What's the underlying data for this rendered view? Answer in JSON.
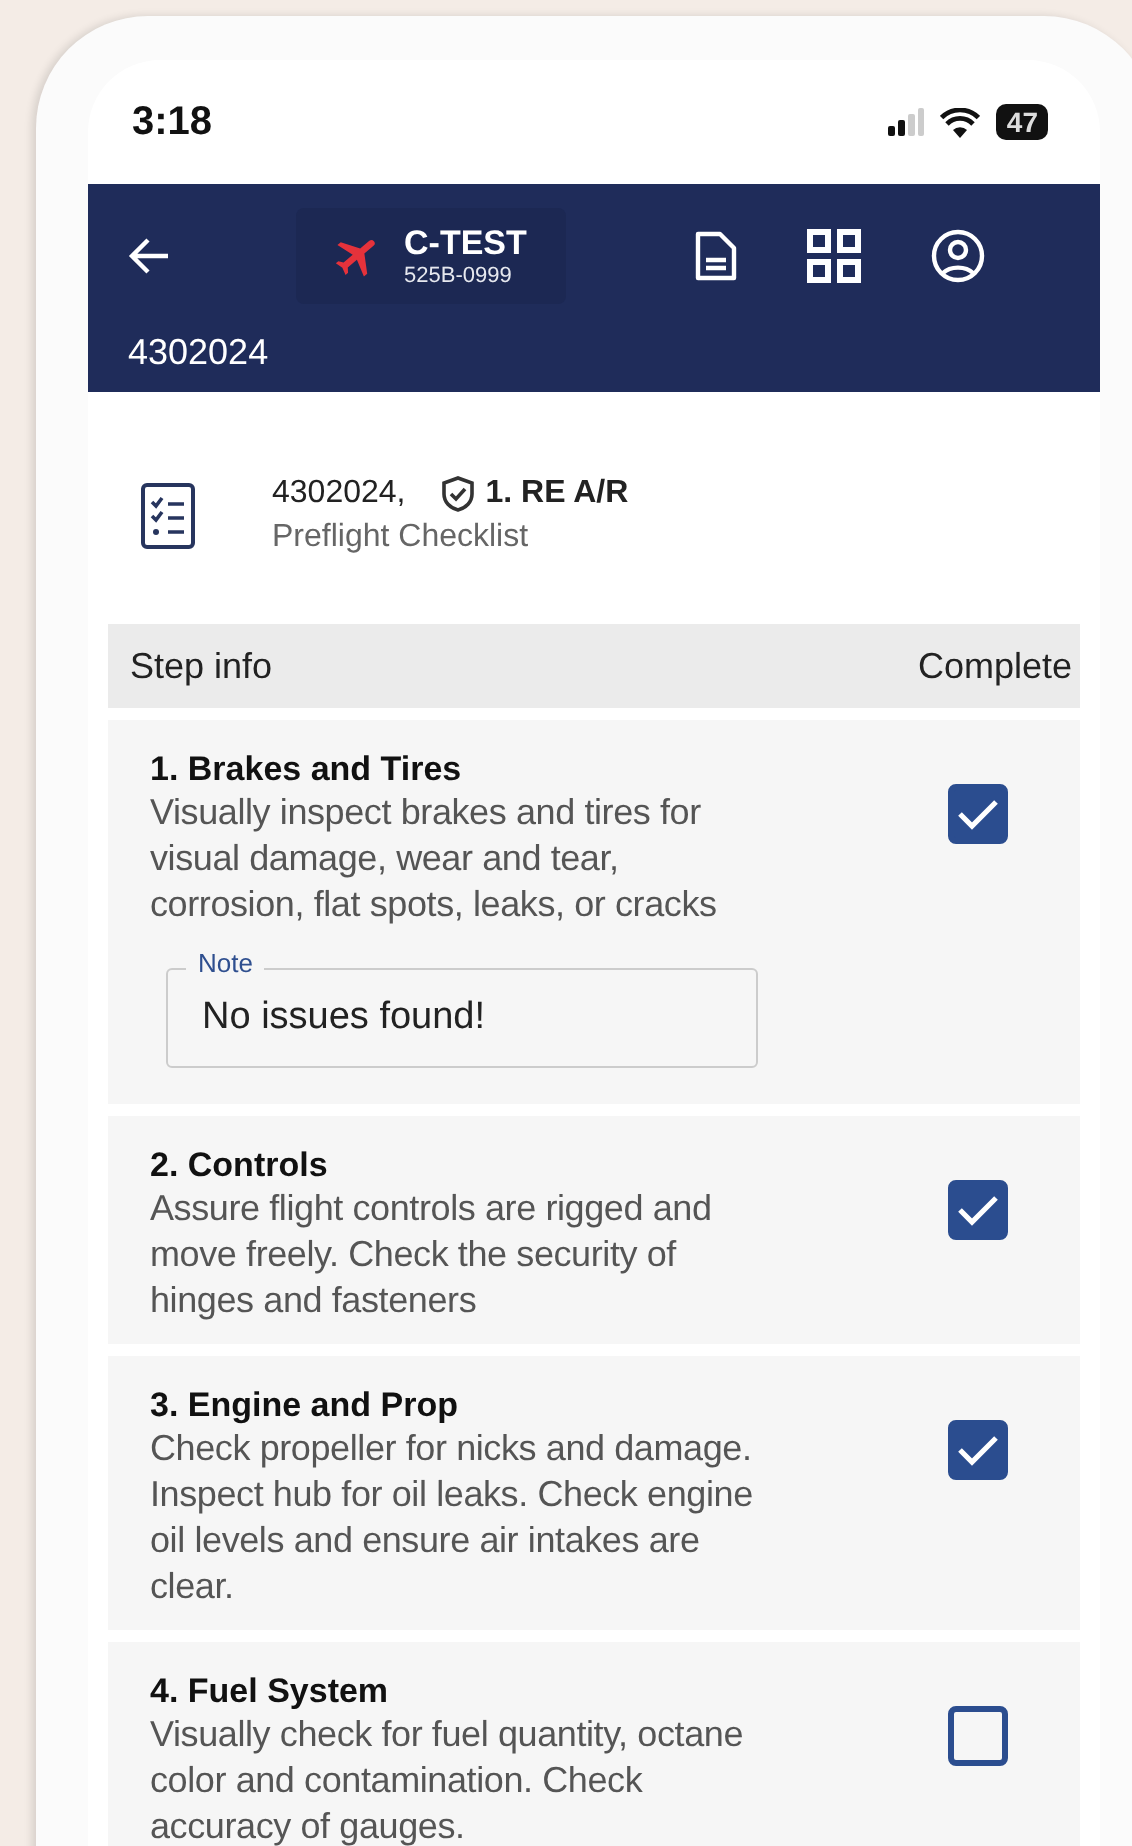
{
  "status_bar": {
    "time": "3:18",
    "battery": "47"
  },
  "header": {
    "aircraft": "C-TEST",
    "serial": "525B-0999",
    "work_order": "4302024"
  },
  "checklist_card": {
    "order": "4302024,",
    "step": "1. RE A/R",
    "title": "Preflight Checklist"
  },
  "table": {
    "columns": [
      "Step info",
      "Complete"
    ],
    "rows": [
      {
        "title": "1. Brakes and Tires",
        "description": "Visually inspect brakes and tires for visual damage, wear and tear, corrosion, flat spots, leaks, or cracks",
        "note": {
          "label": "Note",
          "value": "No issues found!"
        },
        "checked": true
      },
      {
        "title": "2. Controls",
        "description": "Assure flight controls are rigged and move freely. Check the security of hinges and fasteners",
        "checked": true
      },
      {
        "title": "3. Engine and Prop",
        "description": "Check propeller for nicks and damage. Inspect hub for oil leaks. Check engine oil levels and ensure air intakes are clear.",
        "checked": true
      },
      {
        "title": "4. Fuel System",
        "description": "Visually check for fuel quantity, octane color and contamination. Check accuracy of gauges.",
        "checked": false
      }
    ]
  }
}
